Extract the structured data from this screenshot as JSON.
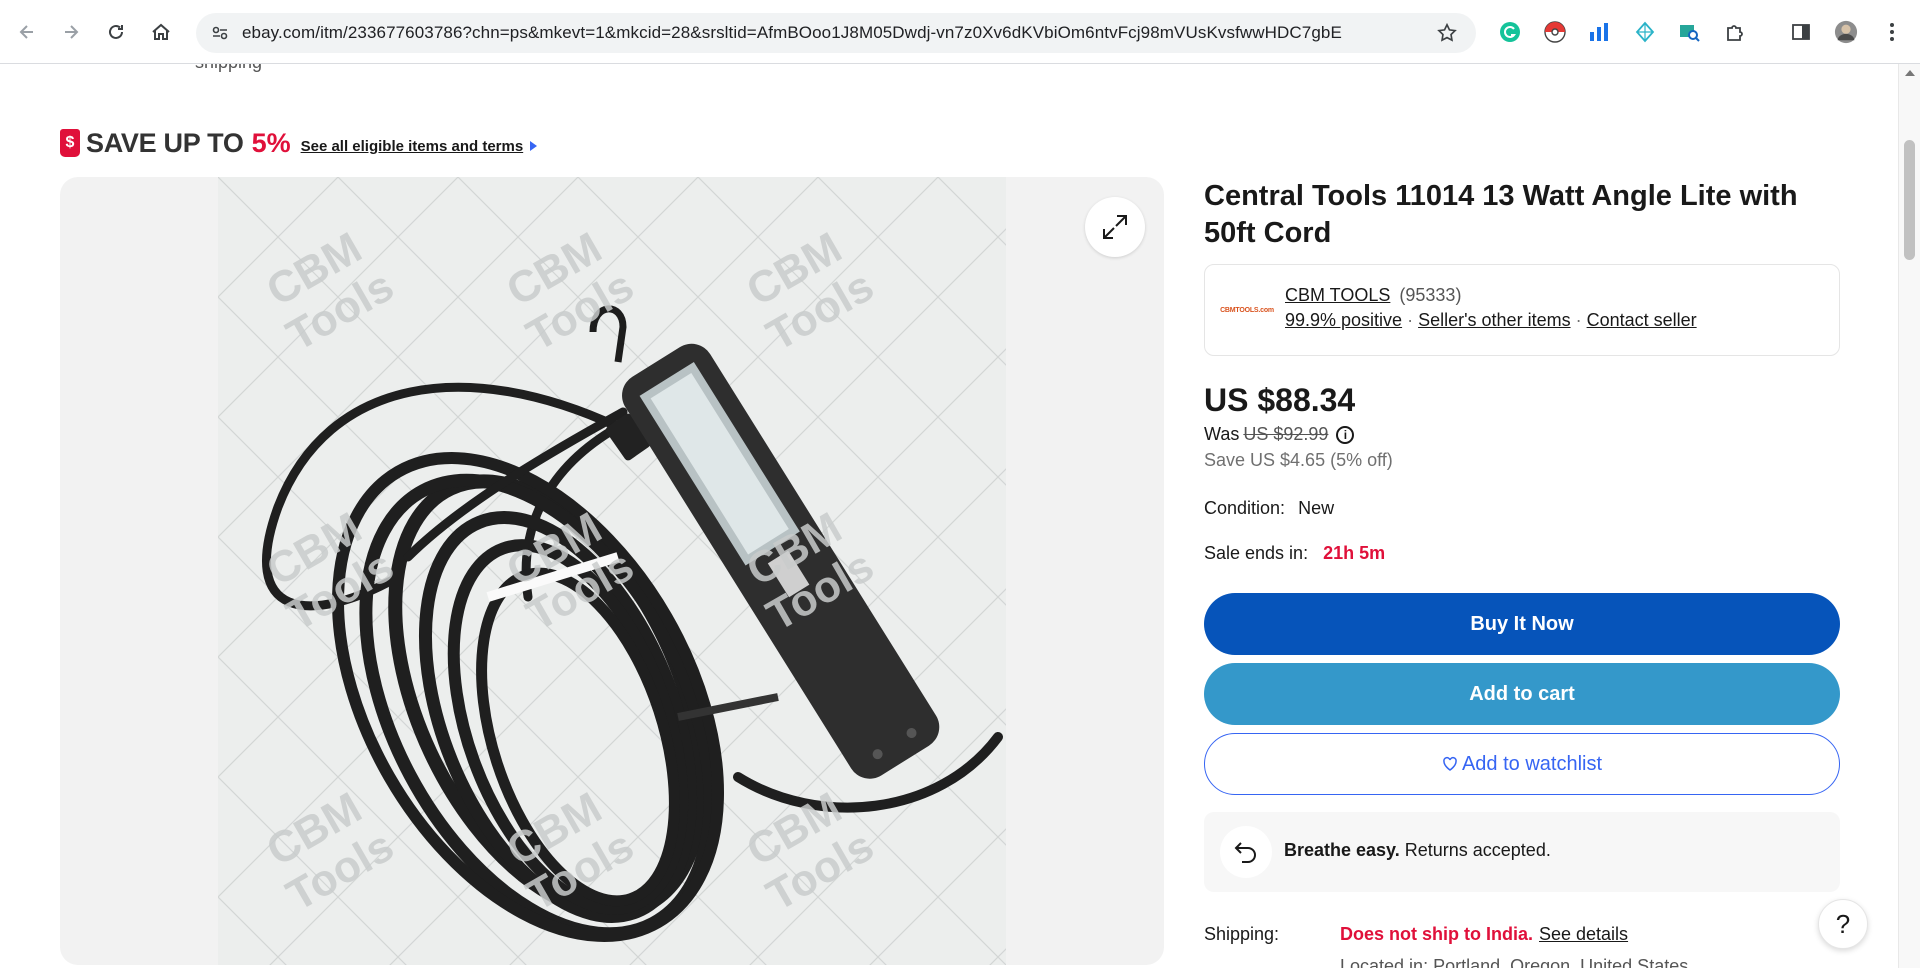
{
  "browser": {
    "url": "ebay.com/itm/233677603786?chn=ps&mkevt=1&mkcid=28&srsltid=AfmBOoo1J8M05Dwdj-vn7z0Xv6dKVbiOm6ntvFcj98mVUsKvsfwwHDC7gbE"
  },
  "page": {
    "prev_text": "shipping",
    "promo": {
      "save_label": "SAVE UP TO",
      "percent": "5%",
      "terms_link": "See all eligible items and terms"
    },
    "gallery": {
      "watermark": "CBM Tools"
    },
    "listing": {
      "title": "Central Tools 11014 13 Watt Angle Lite with 50ft Cord",
      "seller": {
        "logo_text": "CBMTOOLS.com",
        "name": "CBM TOOLS",
        "feedback_count": "(95333)",
        "positive": "99.9% positive",
        "other_items": "Seller's other items",
        "contact": "Contact seller",
        "separator": "·"
      },
      "price": "US $88.34",
      "was_label": "Was",
      "was_price": "US $92.99",
      "info_glyph": "i",
      "savings": "Save US $4.65 (5% off)",
      "condition_label": "Condition:",
      "condition_value": "New",
      "sale_label": "Sale ends in:",
      "sale_value": "21h 5m",
      "buy_now": "Buy It Now",
      "add_to_cart": "Add to cart",
      "watchlist": "Add to watchlist",
      "returns_bold": "Breathe easy.",
      "returns_text": "Returns accepted.",
      "shipping_label": "Shipping:",
      "shipping_status": "Does not ship to India.",
      "shipping_details": "See details",
      "located": "Located in: Portland, Oregon, United States"
    },
    "help_label": "?"
  },
  "colors": {
    "accent_blue": "#3665f3",
    "buy_blue": "#0654ba",
    "cart_blue": "#3498ca",
    "sale_red": "#e0103a"
  }
}
